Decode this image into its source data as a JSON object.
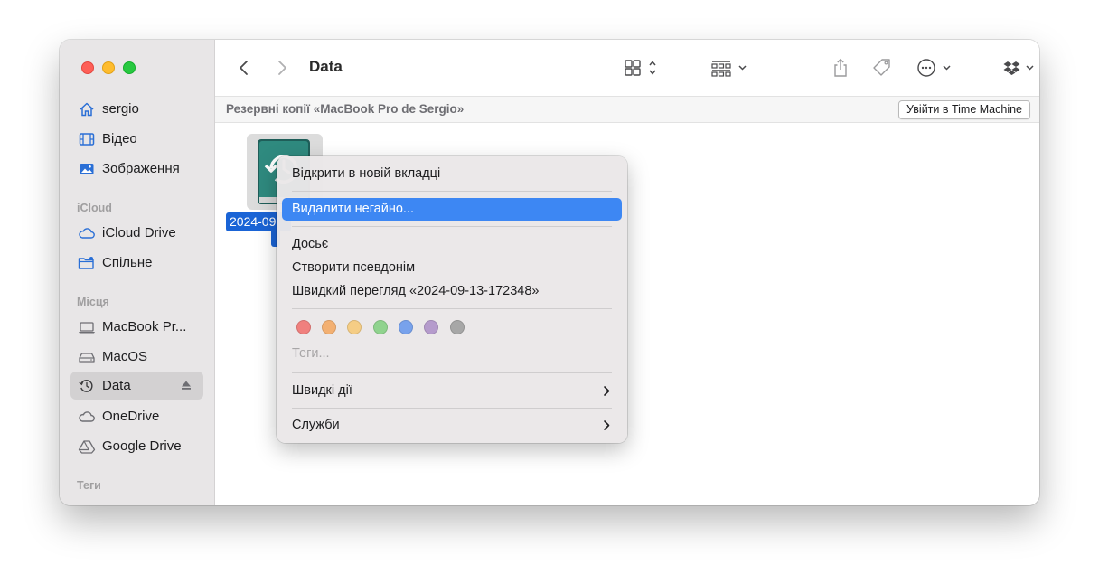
{
  "window": {
    "title": "Data"
  },
  "sidebar": {
    "favorites": [
      {
        "label": "sergio",
        "icon": "home-icon"
      },
      {
        "label": "Відео",
        "icon": "film-icon"
      },
      {
        "label": "Зображення",
        "icon": "photo-icon"
      }
    ],
    "icloud_heading": "iCloud",
    "icloud": [
      {
        "label": "iCloud Drive",
        "icon": "cloud-icon"
      },
      {
        "label": "Спільне",
        "icon": "shared-folder-icon"
      }
    ],
    "places_heading": "Місця",
    "places": [
      {
        "label": "MacBook Pr...",
        "icon": "laptop-icon"
      },
      {
        "label": "MacOS",
        "icon": "disk-icon"
      },
      {
        "label": "Data",
        "icon": "time-machine-icon",
        "selected": true
      },
      {
        "label": "OneDrive",
        "icon": "cloud-icon"
      },
      {
        "label": "Google Drive",
        "icon": "google-drive-icon"
      }
    ],
    "tags_heading": "Теги"
  },
  "pathbar": {
    "location": "Резервні копії «MacBook Pro de Sergio»",
    "time_machine_button": "Увійти в Time Machine"
  },
  "file": {
    "name": "2024-09-13-172348",
    "label_visible": "2024-09"
  },
  "context_menu": {
    "open_new_tab": "Відкрити в новій вкладці",
    "delete_now": "Видалити негайно...",
    "get_info": "Досьє",
    "make_alias": "Створити псевдонім",
    "quick_look": "Швидкий перегляд «2024-09-13-172348»",
    "tags_placeholder": "Теги...",
    "quick_actions": "Швидкі дії",
    "services": "Служби",
    "tag_colors": [
      "#f0807e",
      "#f3b072",
      "#f5cd85",
      "#90d38e",
      "#78a2ec",
      "#b59bcc",
      "#a7a7a7"
    ]
  }
}
